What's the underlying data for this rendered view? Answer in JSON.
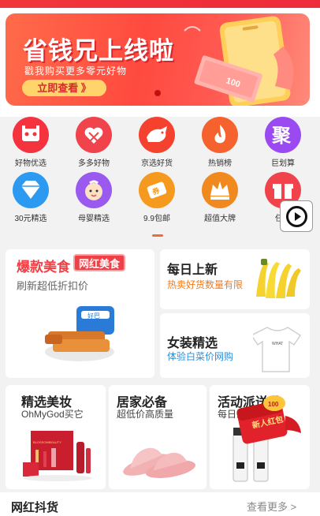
{
  "banner": {
    "title": "省钱兄上线啦",
    "subtitle": "戳我购买更多零元好物",
    "button_label": "立即查看 》",
    "note_value": "100"
  },
  "categories": [
    {
      "label": "好物优选",
      "icon": "tmall-cat-icon",
      "color": "#f5333e"
    },
    {
      "label": "多多好物",
      "icon": "pinduoduo-heart-icon",
      "color": "#f0434b"
    },
    {
      "label": "京选好货",
      "icon": "jd-dog-icon",
      "color": "#f5422e"
    },
    {
      "label": "热销榜",
      "icon": "flame-icon",
      "color": "#f6622e"
    },
    {
      "label": "巨划算",
      "icon": "ju-icon",
      "color": "#9a4af0"
    },
    {
      "label": "30元精选",
      "icon": "diamond-icon",
      "color": "#2c9af0"
    },
    {
      "label": "母婴精选",
      "icon": "baby-icon",
      "color": "#9a5af0"
    },
    {
      "label": "9.9包邮",
      "icon": "coupon-icon",
      "color": "#f59a1e"
    },
    {
      "label": "超值大牌",
      "icon": "crown-icon",
      "color": "#f08a1e"
    },
    {
      "label": "任务",
      "icon": "gift-icon",
      "color": "#f0434b"
    }
  ],
  "ju_glyph": "聚",
  "hot_food": {
    "title": "爆款美食",
    "tag": "网红美食",
    "subtitle": "刷新超低折扣价",
    "package_text": "好巴"
  },
  "daily_new": {
    "title": "每日上新",
    "subtitle": "热卖好货数量有限"
  },
  "women": {
    "title": "女装精选",
    "subtitle": "体验白菜价网购",
    "shirt_text": "WHAT"
  },
  "makeup": {
    "title": "精选美妆",
    "subtitle": "OhMyGod买它",
    "box_text": "BLOSSOMBEAUTY"
  },
  "home": {
    "title": "居家必备",
    "subtitle": "超低价高质量"
  },
  "activity": {
    "title": "活动派送啦",
    "subtitle": "每日派送",
    "envelope_text": "新人红包",
    "coin_text": "100"
  },
  "section": {
    "title": "网红抖货",
    "more": "查看更多 >"
  }
}
